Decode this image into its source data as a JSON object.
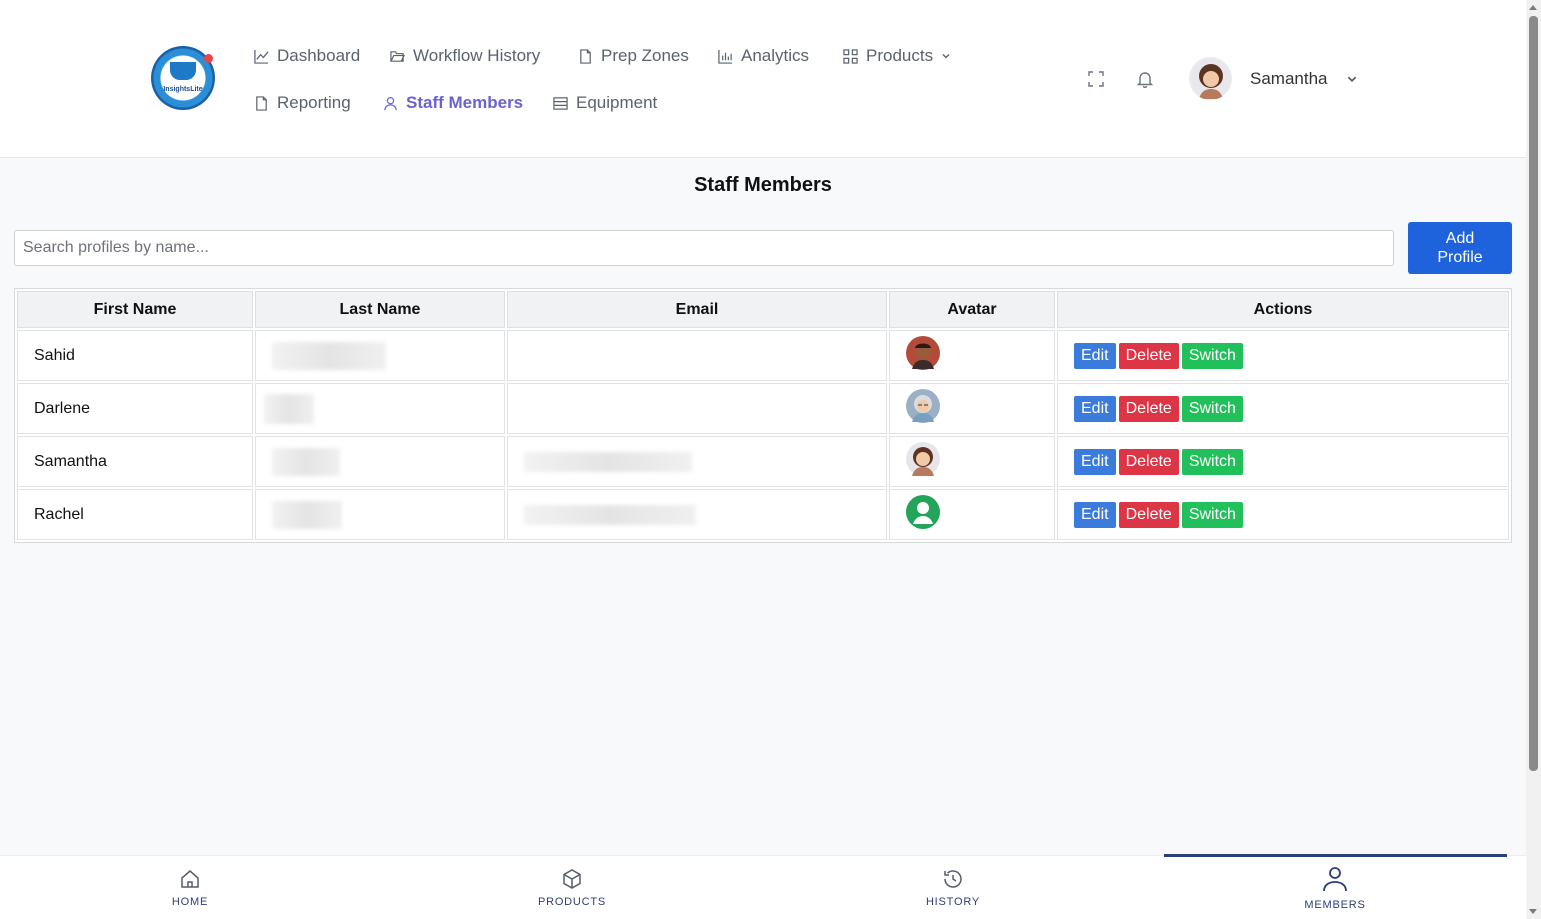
{
  "brand": {
    "logo_text": "InsightsLite"
  },
  "nav": {
    "dashboard": "Dashboard",
    "workflow_history": "Workflow History",
    "prep_zones": "Prep Zones",
    "analytics": "Analytics",
    "products": "Products",
    "reporting": "Reporting",
    "staff_members": "Staff Members",
    "equipment": "Equipment"
  },
  "user": {
    "name": "Samantha"
  },
  "page": {
    "title": "Staff Members"
  },
  "search": {
    "placeholder": "Search profiles by name..."
  },
  "add_button": {
    "line1": "Add",
    "line2": "Profile"
  },
  "table": {
    "headers": {
      "first_name": "First Name",
      "last_name": "Last Name",
      "email": "Email",
      "avatar": "Avatar",
      "actions": "Actions"
    },
    "rows": [
      {
        "first_name": "Sahid",
        "avatar": "avatar-man-dark"
      },
      {
        "first_name": "Darlene",
        "avatar": "avatar-woman-grey"
      },
      {
        "first_name": "Samantha",
        "avatar": "avatar-woman-brown"
      },
      {
        "first_name": "Rachel",
        "avatar": "avatar-default-green"
      }
    ],
    "action_labels": {
      "edit": "Edit",
      "delete": "Delete",
      "switch": "Switch"
    }
  },
  "bottom_nav": {
    "home": "HOME",
    "products": "PRODUCTS",
    "history": "HISTORY",
    "members": "MEMBERS"
  },
  "colors": {
    "accent": "#6a62d1",
    "primary_button": "#1f63dc",
    "edit": "#3a7bdc",
    "delete": "#dc3545",
    "switch": "#22c05a",
    "bottom_nav": "#2c3e7a"
  }
}
